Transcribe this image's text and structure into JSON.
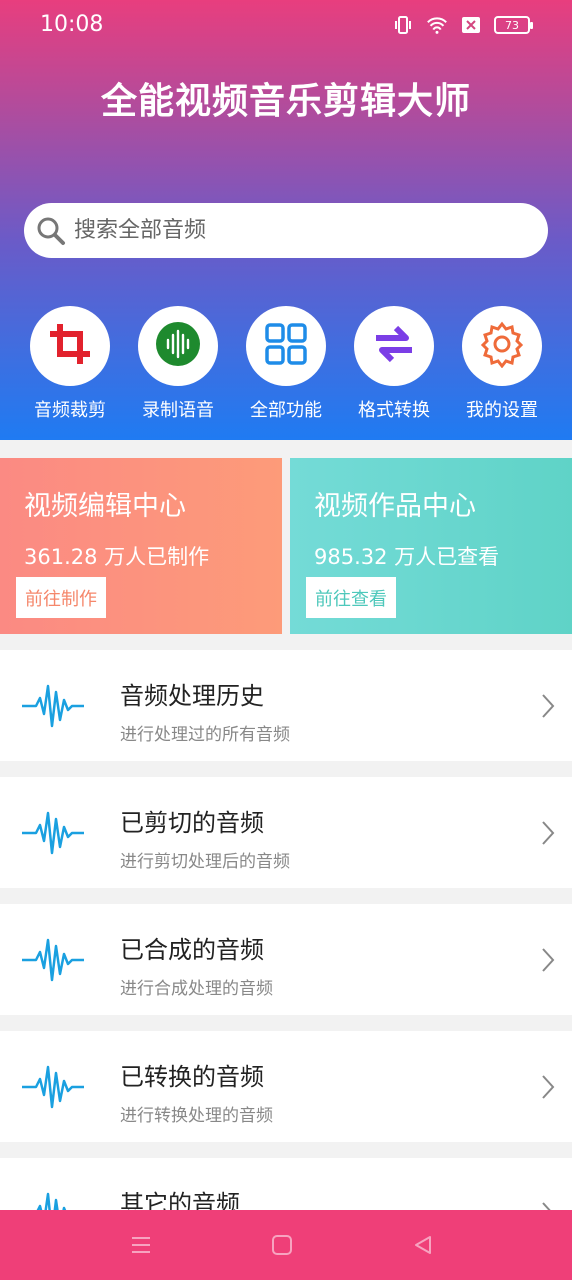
{
  "status": {
    "time": "10:08",
    "battery": "73"
  },
  "app": {
    "title": "全能视频音乐剪辑大师"
  },
  "search": {
    "placeholder": "搜索全部音频"
  },
  "quick_actions": [
    {
      "label": "音频裁剪",
      "icon": "crop-icon"
    },
    {
      "label": "录制语音",
      "icon": "voice-record-icon"
    },
    {
      "label": "全部功能",
      "icon": "grid-icon"
    },
    {
      "label": "格式转换",
      "icon": "convert-icon"
    },
    {
      "label": "我的设置",
      "icon": "gear-icon"
    }
  ],
  "cards": {
    "edit": {
      "title": "视频编辑中心",
      "stat": "361.28 万人已制作",
      "button": "前往制作"
    },
    "works": {
      "title": "视频作品中心",
      "stat": "985.32 万人已查看",
      "button": "前往查看"
    }
  },
  "list": [
    {
      "title": "音频处理历史",
      "subtitle": "进行处理过的所有音频"
    },
    {
      "title": "已剪切的音频",
      "subtitle": "进行剪切处理后的音频"
    },
    {
      "title": "已合成的音频",
      "subtitle": "进行合成处理的音频"
    },
    {
      "title": "已转换的音频",
      "subtitle": "进行转换处理的音频"
    },
    {
      "title": "其它的音频",
      "subtitle": ""
    }
  ],
  "colors": {
    "accent_pink": "#ef3f78",
    "accent_blue": "#1f7bf2",
    "wave_blue": "#1aa0e0",
    "card_orange": "#fd9b79",
    "card_teal": "#5fd3c7"
  }
}
